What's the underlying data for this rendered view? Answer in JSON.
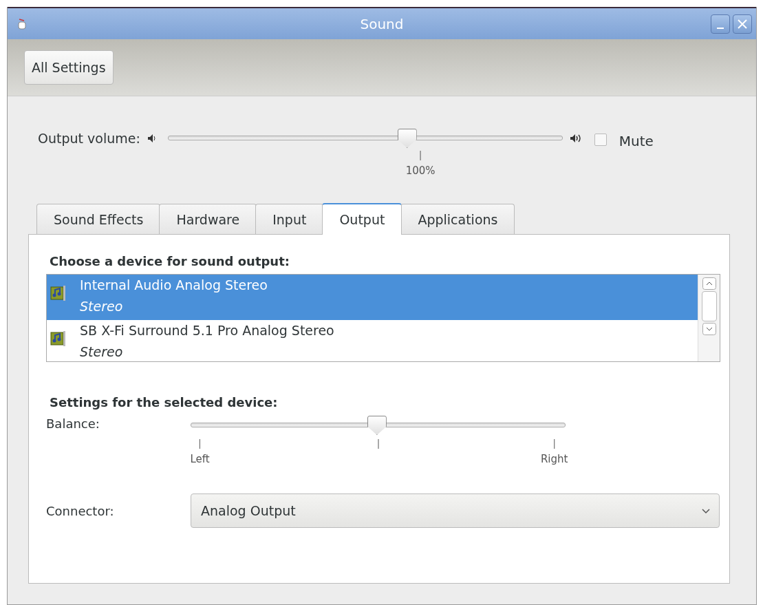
{
  "window": {
    "title": "Sound"
  },
  "toolbar": {
    "button": "All Settings"
  },
  "output_volume": {
    "label": "Output volume:",
    "level": 0.606,
    "mark": "100%",
    "mute": {
      "label": "Mute",
      "checked": false
    }
  },
  "tabs": [
    {
      "label": "Sound Effects",
      "selected": false
    },
    {
      "label": "Hardware",
      "selected": false
    },
    {
      "label": "Input",
      "selected": false
    },
    {
      "label": "Output",
      "selected": true
    },
    {
      "label": "Applications",
      "selected": false
    }
  ],
  "device_heading": "Choose a device for sound output:",
  "devices": [
    {
      "name": "Internal Audio Analog Stereo",
      "profile": "Stereo",
      "selected": true
    },
    {
      "name": "SB X-Fi Surround 5.1 Pro Analog Stereo",
      "profile": "Stereo",
      "selected": false
    }
  ],
  "settings_heading": "Settings for the selected device:",
  "balance": {
    "label": "Balance:",
    "level": 0.497,
    "marks": [
      "Left",
      "Right"
    ]
  },
  "connector": {
    "label": "Connector:",
    "value": "Analog Output"
  }
}
